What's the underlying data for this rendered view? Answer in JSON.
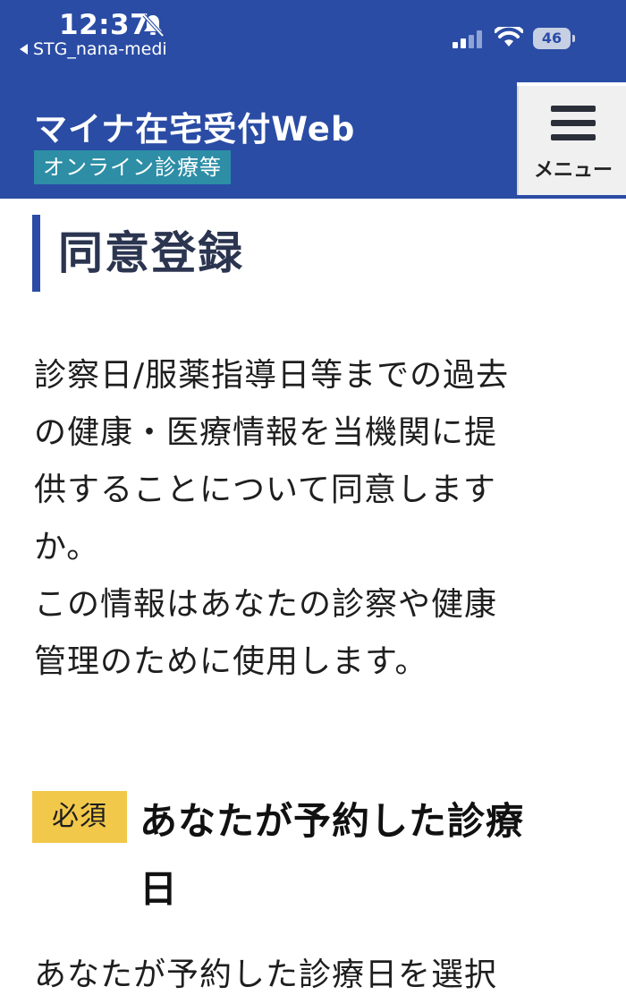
{
  "status_bar": {
    "time": "12:37",
    "back_app": "STG_nana-medi",
    "battery": "46"
  },
  "header": {
    "title": "マイナ在宅受付Web",
    "subtitle": "オンライン診療等",
    "menu_label": "メニュー"
  },
  "page": {
    "title": "同意登録",
    "description_lines": [
      "診察日/服薬指導日等までの過去",
      "の健康・医療情報を当機関に提",
      "供することについて同意します",
      "か。",
      "この情報はあなたの診察や健康",
      "管理のために使用します。"
    ]
  },
  "section": {
    "required_badge": "必須",
    "title_line1": "あなたが予約した診療",
    "title_line2": "日",
    "description": "あなたが予約した診療日を選択"
  },
  "colors": {
    "brand_blue": "#2a4ca5",
    "teal_badge": "#2d8ea6",
    "required_yellow": "#f2c84a"
  }
}
